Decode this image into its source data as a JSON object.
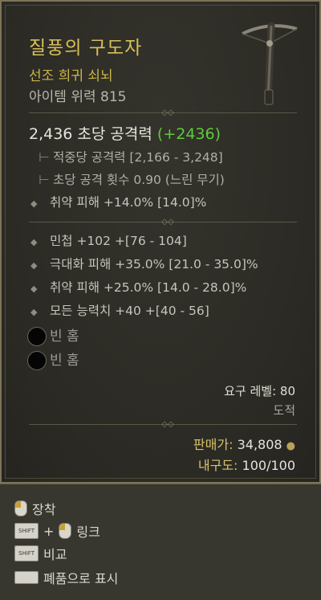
{
  "item": {
    "name": "질풍의 구도자",
    "rarity": "선조 희귀 쇠뇌",
    "item_power": "아이템 위력 815",
    "dps": "2,436 초당 공격력",
    "dps_delta": "(+2436)",
    "damage_per_hit": "적중당 공격력 [2,166 - 3,248]",
    "attack_speed": "초당 공격 횟수 0.90 (느린 무기)",
    "implicit": "취약 피해 +14.0% [14.0]%",
    "affixes": [
      "민첩 +102 +[76 - 104]",
      "극대화 피해 +35.0% [21.0 - 35.0]%",
      "취약 피해 +25.0% [14.0 - 28.0]%",
      "모든 능력치 +40 +[40 - 56]"
    ],
    "sockets": [
      "빈 홈",
      "빈 홈"
    ],
    "required_level": "요구 레벨: 80",
    "class": "도적",
    "sell_label": "판매가:",
    "sell_value": "34,808",
    "durability_label": "내구도:",
    "durability_value": "100/100"
  },
  "footer": {
    "equip": "장착",
    "link": "링크",
    "compare": "비교",
    "junk": "폐품으로 표시",
    "shift_key": "SHIFT"
  },
  "colors": {
    "title": "#d7c05a",
    "positive_delta": "#5ecc3a",
    "border": "#7d7358"
  }
}
